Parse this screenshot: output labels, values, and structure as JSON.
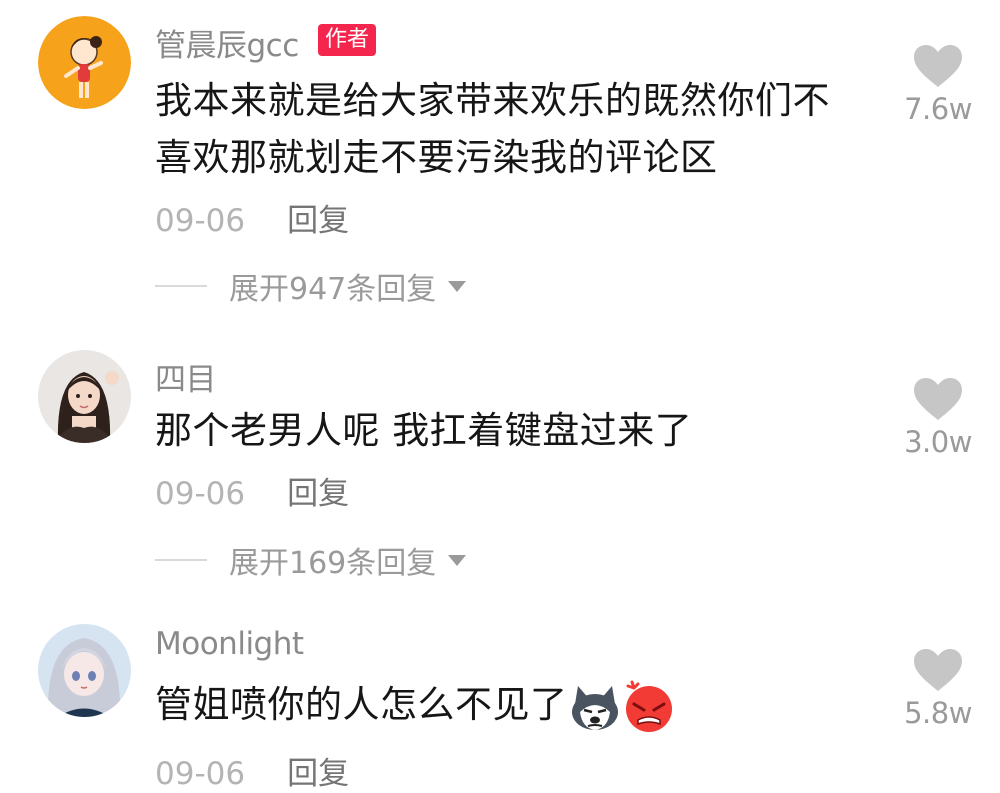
{
  "comments": [
    {
      "username": "管晨辰gcc",
      "badge": "作者",
      "text": "我本来就是给大家带来欢乐的既然你们不喜欢那就划走不要污染我的评论区",
      "date": "09-06",
      "reply_label": "回复",
      "expand_label": "展开947条回复",
      "likes": "7.6w",
      "avatar_icon": "cartoon-girl-avatar"
    },
    {
      "username": "四目",
      "text": "那个老男人呢 我扛着键盘过来了",
      "date": "09-06",
      "reply_label": "回复",
      "expand_label": "展开169条回复",
      "likes": "3.0w",
      "avatar_icon": "photo-girl-avatar"
    },
    {
      "username": "Moonlight",
      "text": "管姐喷你的人怎么不见了",
      "emojis": [
        "husky-dog-emoji",
        "angry-face-emoji"
      ],
      "date": "09-06",
      "reply_label": "回复",
      "likes": "5.8w",
      "avatar_icon": "anime-girl-avatar"
    }
  ],
  "colors": {
    "badge": "#f5264d",
    "username": "#8a8a8a",
    "text": "#161616",
    "muted": "#b4b4b4",
    "like_icon": "#c6c6c6"
  }
}
